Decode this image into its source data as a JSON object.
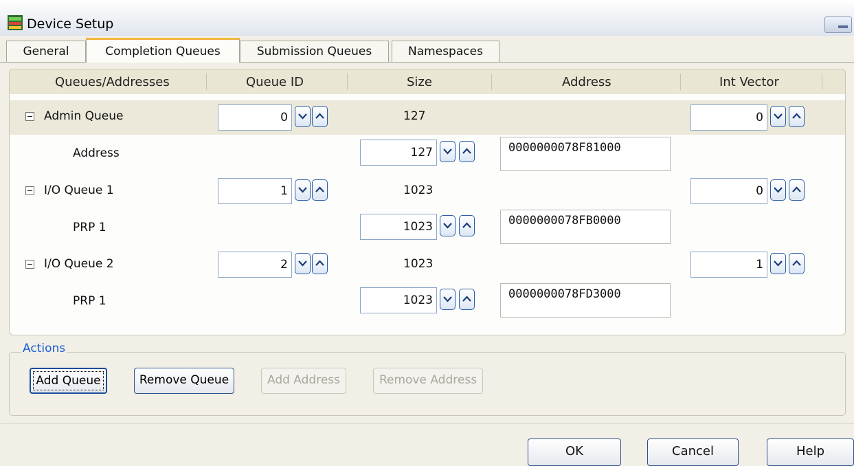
{
  "window": {
    "title": "Device Setup"
  },
  "tabs": [
    {
      "label": "General",
      "active": false
    },
    {
      "label": "Completion Queues",
      "active": true
    },
    {
      "label": "Submission Queues",
      "active": false
    },
    {
      "label": "Namespaces",
      "active": false
    }
  ],
  "grid": {
    "columns": [
      "Queues/Addresses",
      "Queue ID",
      "Size",
      "Address",
      "Int Vector"
    ],
    "rows": [
      {
        "type": "queue",
        "name": "Admin Queue",
        "queue_id": "0",
        "size": "127",
        "int_vector": "0",
        "selected": true
      },
      {
        "type": "address",
        "name": "Address",
        "size": "127",
        "address": "0000000078F81000"
      },
      {
        "type": "queue",
        "name": "I/O Queue 1",
        "queue_id": "1",
        "size": "1023",
        "int_vector": "0",
        "selected": false
      },
      {
        "type": "address",
        "name": "PRP 1",
        "size": "1023",
        "address": "0000000078FB0000"
      },
      {
        "type": "queue",
        "name": "I/O Queue 2",
        "queue_id": "2",
        "size": "1023",
        "int_vector": "1",
        "selected": false
      },
      {
        "type": "address",
        "name": "PRP 1",
        "size": "1023",
        "address": "0000000078FD3000"
      }
    ]
  },
  "actions": {
    "legend": "Actions",
    "add_queue": "Add Queue",
    "remove_queue": "Remove Queue",
    "add_address": "Add Address",
    "remove_address": "Remove Address"
  },
  "footer": {
    "ok": "OK",
    "cancel": "Cancel",
    "help": "Help"
  },
  "icons": {
    "collapse": "minus-box-icon",
    "spin_down": "chevron-down-icon",
    "spin_up": "chevron-up-icon"
  },
  "colors": {
    "accent_tab": "#f1b740",
    "legend": "#1a5fd6",
    "header_bg": "#e9e6d3"
  }
}
